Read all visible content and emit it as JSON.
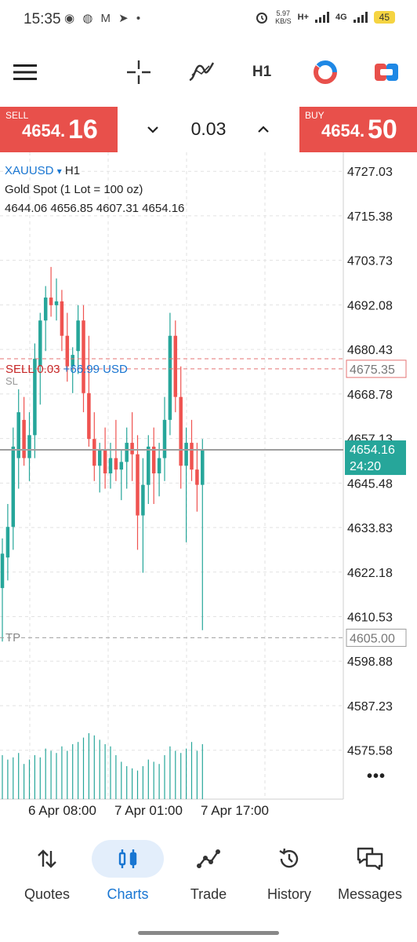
{
  "status_bar": {
    "time": "15:35",
    "left_icons": "◉ ◍ M ➤ •",
    "net_speed_value": "5.97",
    "net_speed_unit": "KB/S",
    "network_hplus": "H+",
    "network_4g": "4G",
    "battery": "45"
  },
  "toolbar": {
    "menu_icon": "hamburger-menu-icon",
    "crosshair_icon": "crosshair-icon",
    "indicators_icon": "indicators-icon",
    "timeframe": "H1",
    "theme_icon": "chart-type-icon",
    "trade_icon": "one-click-trade-icon"
  },
  "trade_bar": {
    "sell_label": "SELL",
    "sell_price_small": "4654.",
    "sell_price_big": "16",
    "lot": "0.03",
    "buy_label": "BUY",
    "buy_price_small": "4654.",
    "buy_price_big": "50",
    "sell_color": "#e8504b",
    "buy_color": "#e8504b"
  },
  "chart_info": {
    "symbol": "XAUUSD",
    "symbol_dropdown": "▾",
    "timeframe": "H1",
    "description": "Gold Spot (1 Lot = 100 oz)",
    "ohlc": "4644.06 4656.85 4607.31 4654.16",
    "position_label": "SELL 0.03",
    "position_profit": "+66.99 USD",
    "sl_label": "SL",
    "tp_label": "TP",
    "more_menu": "•••"
  },
  "chart_data": {
    "type": "candlestick",
    "symbol": "XAUUSD",
    "timeframe": "H1",
    "y_ticks": [
      "4727.03",
      "4715.38",
      "4703.73",
      "4692.08",
      "4680.43",
      "4668.78",
      "4657.13",
      "4645.48",
      "4633.83",
      "4622.18",
      "4610.53",
      "4598.88",
      "4587.23",
      "4575.58"
    ],
    "ylim": [
      4571.0,
      4732.0
    ],
    "x_labels": [
      "6 Apr 08:00",
      "7 Apr 01:00",
      "7 Apr 17:00"
    ],
    "current_price": "4654.16",
    "countdown": "24:20",
    "current_price_value": 4654.16,
    "sl_price": "4675.35",
    "sl_price_value": 4675.35,
    "entry_price_value": 4678.0,
    "tp_price": "4605.00",
    "tp_price_value": 4605.0,
    "up_color": "#26a69a",
    "down_color": "#ef5350",
    "candles": [
      {
        "o": 4618,
        "h": 4631,
        "l": 4604,
        "c": 4627
      },
      {
        "o": 4626,
        "h": 4640,
        "l": 4620,
        "c": 4634
      },
      {
        "o": 4634,
        "h": 4660,
        "l": 4628,
        "c": 4655
      },
      {
        "o": 4652,
        "h": 4670,
        "l": 4644,
        "c": 4664
      },
      {
        "o": 4662,
        "h": 4668,
        "l": 4650,
        "c": 4652
      },
      {
        "o": 4652,
        "h": 4664,
        "l": 4646,
        "c": 4658
      },
      {
        "o": 4658,
        "h": 4682,
        "l": 4652,
        "c": 4678
      },
      {
        "o": 4676,
        "h": 4690,
        "l": 4666,
        "c": 4688
      },
      {
        "o": 4688,
        "h": 4697,
        "l": 4680,
        "c": 4694
      },
      {
        "o": 4694,
        "h": 4702,
        "l": 4689,
        "c": 4692
      },
      {
        "o": 4692,
        "h": 4699,
        "l": 4688,
        "c": 4693
      },
      {
        "o": 4693,
        "h": 4696,
        "l": 4680,
        "c": 4684
      },
      {
        "o": 4684,
        "h": 4690,
        "l": 4672,
        "c": 4676
      },
      {
        "o": 4676,
        "h": 4681,
        "l": 4669,
        "c": 4679
      },
      {
        "o": 4680,
        "h": 4692,
        "l": 4674,
        "c": 4688
      },
      {
        "o": 4688,
        "h": 4692,
        "l": 4664,
        "c": 4669
      },
      {
        "o": 4669,
        "h": 4684,
        "l": 4655,
        "c": 4657
      },
      {
        "o": 4657,
        "h": 4664,
        "l": 4646,
        "c": 4650
      },
      {
        "o": 4650,
        "h": 4656,
        "l": 4643,
        "c": 4654
      },
      {
        "o": 4654,
        "h": 4660,
        "l": 4644,
        "c": 4648
      },
      {
        "o": 4648,
        "h": 4656,
        "l": 4644,
        "c": 4652
      },
      {
        "o": 4652,
        "h": 4662,
        "l": 4646,
        "c": 4649
      },
      {
        "o": 4649,
        "h": 4654,
        "l": 4641,
        "c": 4651
      },
      {
        "o": 4651,
        "h": 4660,
        "l": 4644,
        "c": 4656
      },
      {
        "o": 4656,
        "h": 4664,
        "l": 4646,
        "c": 4653
      },
      {
        "o": 4653,
        "h": 4658,
        "l": 4628,
        "c": 4637
      },
      {
        "o": 4637,
        "h": 4652,
        "l": 4622,
        "c": 4645
      },
      {
        "o": 4645,
        "h": 4658,
        "l": 4640,
        "c": 4655
      },
      {
        "o": 4655,
        "h": 4660,
        "l": 4640,
        "c": 4648
      },
      {
        "o": 4648,
        "h": 4656,
        "l": 4642,
        "c": 4652
      },
      {
        "o": 4652,
        "h": 4668,
        "l": 4646,
        "c": 4662
      },
      {
        "o": 4662,
        "h": 4690,
        "l": 4658,
        "c": 4684
      },
      {
        "o": 4684,
        "h": 4688,
        "l": 4664,
        "c": 4668
      },
      {
        "o": 4668,
        "h": 4676,
        "l": 4644,
        "c": 4650
      },
      {
        "o": 4650,
        "h": 4660,
        "l": 4630,
        "c": 4656
      },
      {
        "o": 4656,
        "h": 4662,
        "l": 4646,
        "c": 4649
      },
      {
        "o": 4649,
        "h": 4656,
        "l": 4638,
        "c": 4645
      },
      {
        "o": 4645,
        "h": 4657,
        "l": 4607,
        "c": 4654
      }
    ],
    "volumes": [
      20,
      18,
      19,
      21,
      16,
      18,
      20,
      19,
      23,
      22,
      21,
      24,
      22,
      25,
      26,
      28,
      30,
      29,
      27,
      25,
      24,
      20,
      17,
      15,
      14,
      13,
      15,
      18,
      17,
      16,
      20,
      24,
      22,
      21,
      23,
      26,
      22,
      25
    ]
  },
  "bottom_nav": {
    "items": [
      {
        "label": "Quotes",
        "icon": "quotes-icon"
      },
      {
        "label": "Charts",
        "icon": "charts-icon",
        "active": true
      },
      {
        "label": "Trade",
        "icon": "trade-icon"
      },
      {
        "label": "History",
        "icon": "history-icon"
      },
      {
        "label": "Messages",
        "icon": "messages-icon"
      }
    ],
    "active_color": "#1976d2"
  }
}
